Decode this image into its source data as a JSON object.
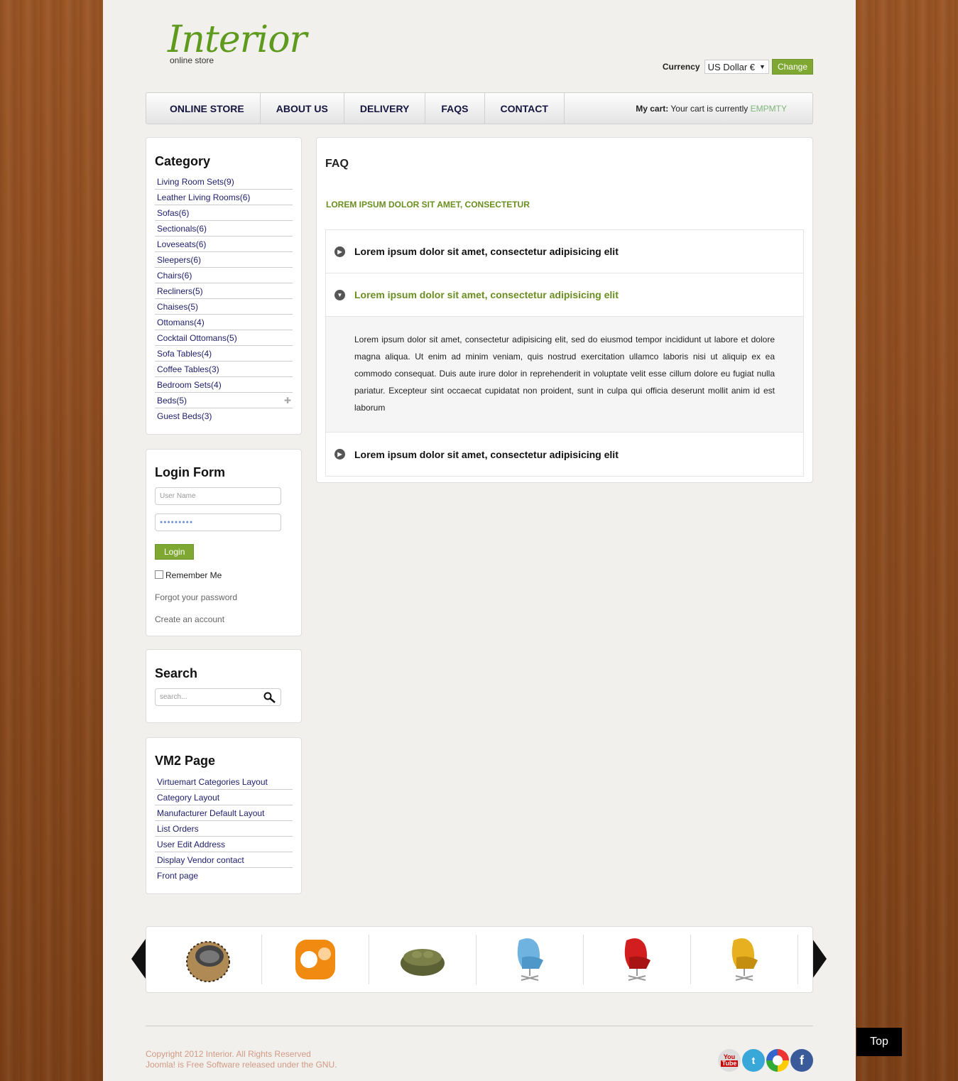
{
  "header": {
    "logo_title": "Interior",
    "logo_subtitle": "online store",
    "currency_label": "Currency",
    "currency_selected": "US Dollar €",
    "change_label": "Change"
  },
  "nav": {
    "items": [
      "ONLINE STORE",
      "ABOUT US",
      "DELIVERY",
      "FAQS",
      "CONTACT"
    ],
    "cart_label": "My cart:",
    "cart_text": "Your cart is currently",
    "cart_status": "EMPMTY"
  },
  "category": {
    "title": "Category",
    "items": [
      "Living Room Sets(9)",
      "Leather Living Rooms(6)",
      "Sofas(6)",
      "Sectionals(6)",
      "Loveseats(6)",
      "Sleepers(6)",
      "Chairs(6)",
      "Recliners(5)",
      "Chaises(5)",
      "Ottomans(4)",
      "Cocktail Ottomans(5)",
      "Sofa Tables(4)",
      "Coffee Tables(3)",
      "Bedroom Sets(4)",
      "Beds(5)",
      "Guest Beds(3)"
    ]
  },
  "login": {
    "title": "Login Form",
    "username_placeholder": "User Name",
    "password_value": "●●●●●●●●●",
    "button": "Login",
    "remember": "Remember Me",
    "forgot": "Forgot your password",
    "create": "Create an account"
  },
  "search": {
    "title": "Search",
    "placeholder": "search..."
  },
  "vm2": {
    "title": "VM2 Page",
    "items": [
      "Virtuemart Categories Layout",
      "Category Layout",
      "Manufacturer Default Layout",
      "List Orders",
      "User Edit Address",
      "Display Vendor contact",
      "Front page"
    ]
  },
  "faq": {
    "title": "FAQ",
    "subtitle": "LOREM IPSUM DOLOR SIT AMET, CONSECTETUR",
    "q1": "Lorem ipsum dolor sit amet, consectetur adipisicing elit",
    "q2": "Lorem ipsum dolor sit amet, consectetur adipisicing elit",
    "a2": "Lorem ipsum dolor sit amet, consectetur adipisicing elit, sed do eiusmod tempor incididunt ut labore et dolore magna aliqua. Ut enim ad minim veniam, quis nostrud exercitation ullamco laboris nisi ut aliquip ex ea commodo consequat. Duis aute irure dolor in reprehenderit in voluptate velit esse cillum dolore eu fugiat nulla pariatur. Excepteur sint occaecat cupidatat non proident, sunt in culpa qui officia deserunt mollit anim id est laborum",
    "q3": "Lorem ipsum dolor sit amet, consectetur adipisicing elit"
  },
  "footer": {
    "copyright": "Copyright 2012 Interior. All Rights Reserved",
    "joomla": "Joomla! is Free Software released under the GNU.",
    "top": "Top"
  },
  "colors": {
    "accent_green": "#7ea832",
    "link_navy": "#1d1d6b"
  }
}
